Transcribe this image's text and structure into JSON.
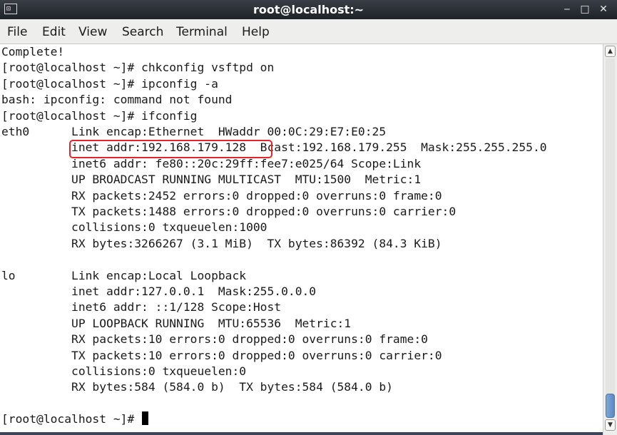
{
  "window": {
    "title": "root@localhost:~",
    "title_icon_glyph": "⊡",
    "minimize_glyph": "‒",
    "maximize_glyph": "□",
    "close_glyph": "✕"
  },
  "menu": {
    "file": "File",
    "edit": "Edit",
    "view": "View",
    "search": "Search",
    "terminal": "Terminal",
    "help": "Help"
  },
  "terminal": {
    "lines": [
      "Complete!",
      "[root@localhost ~]# chkconfig vsftpd on",
      "[root@localhost ~]# ipconfig -a",
      "bash: ipconfig: command not found",
      "[root@localhost ~]# ifconfig",
      "eth0      Link encap:Ethernet  HWaddr 00:0C:29:E7:E0:25  ",
      "          inet addr:192.168.179.128  Bcast:192.168.179.255  Mask:255.255.255.0",
      "          inet6 addr: fe80::20c:29ff:fee7:e025/64 Scope:Link",
      "          UP BROADCAST RUNNING MULTICAST  MTU:1500  Metric:1",
      "          RX packets:2452 errors:0 dropped:0 overruns:0 frame:0",
      "          TX packets:1488 errors:0 dropped:0 overruns:0 carrier:0",
      "          collisions:0 txqueuelen:1000 ",
      "          RX bytes:3266267 (3.1 MiB)  TX bytes:86392 (84.3 KiB)",
      "",
      "lo        Link encap:Local Loopback  ",
      "          inet addr:127.0.0.1  Mask:255.0.0.0",
      "          inet6 addr: ::1/128 Scope:Host",
      "          UP LOOPBACK RUNNING  MTU:65536  Metric:1",
      "          RX packets:10 errors:0 dropped:0 overruns:0 frame:0",
      "          TX packets:10 errors:0 dropped:0 overruns:0 carrier:0",
      "          collisions:0 txqueuelen:0 ",
      "          RX bytes:584 (584.0 b)  TX bytes:584 (584.0 b)",
      "",
      "[root@localhost ~]# "
    ],
    "highlighted_text": "inet addr:192.168.179.128",
    "highlight_color": "#e0262b"
  },
  "scrollbar": {
    "up_glyph": "▲",
    "down_glyph": "▼"
  }
}
